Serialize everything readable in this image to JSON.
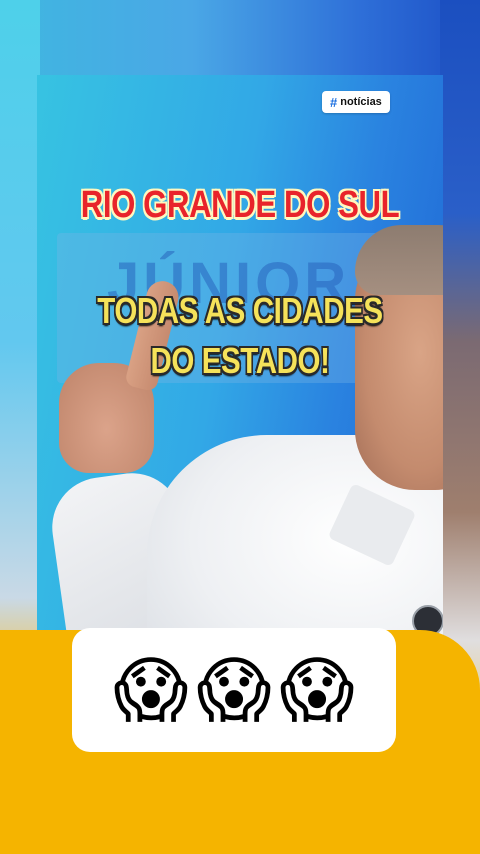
{
  "tag": {
    "hash": "#",
    "label": "notícias"
  },
  "captions": {
    "title": "RIO GRANDE DO SUL",
    "line1": "TODAS AS CIDADES",
    "line2": "DO ESTADO!"
  },
  "banner": {
    "text": "JÚNIOR"
  },
  "reaction": {
    "emojis": [
      "😱",
      "😱",
      "😱"
    ],
    "emoji_name": "face-screaming-in-fear"
  },
  "colors": {
    "accent_yellow": "#f5b400",
    "title_red": "#e8242b",
    "caption_yellow": "#f5e25a"
  }
}
